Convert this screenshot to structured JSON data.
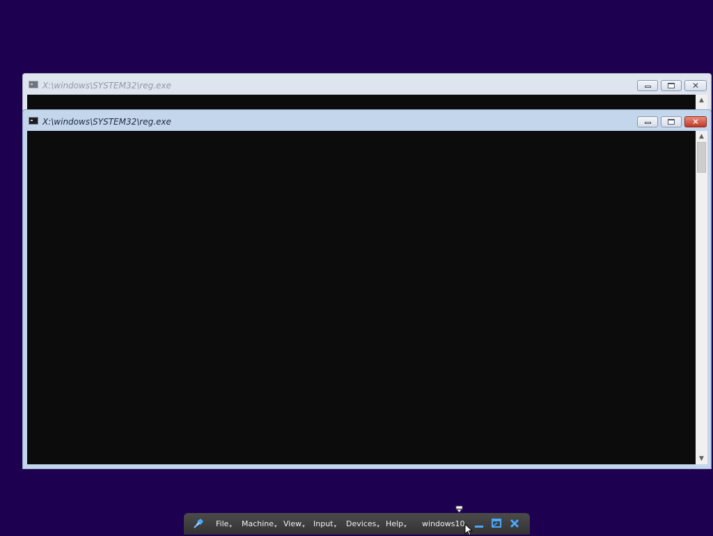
{
  "desktop": {
    "background_color": "#1e0050"
  },
  "windows": [
    {
      "title": "X:\\windows\\SYSTEM32\\reg.exe",
      "state": "inactive",
      "controls": {
        "minimize_icon": "minimize-icon",
        "maximize_icon": "maximize-icon",
        "close_icon": "close-icon"
      }
    },
    {
      "title": "X:\\windows\\SYSTEM32\\reg.exe",
      "state": "active",
      "console_background": "#0c0c0c",
      "controls": {
        "minimize_icon": "minimize-icon",
        "maximize_icon": "maximize-icon",
        "close_icon": "close-icon"
      }
    }
  ],
  "vbox_toolbar": {
    "pin_icon": "pin-icon",
    "menus": [
      {
        "label": "File"
      },
      {
        "label": "Machine"
      },
      {
        "label": "View"
      },
      {
        "label": "Input"
      },
      {
        "label": "Devices"
      },
      {
        "label": "Help"
      }
    ],
    "vm_name": "windows10",
    "minimize_icon": "minimize-icon",
    "restore_icon": "exit-fullscreen-icon",
    "close_icon": "close-icon",
    "accent_color": "#4aa8ff"
  }
}
